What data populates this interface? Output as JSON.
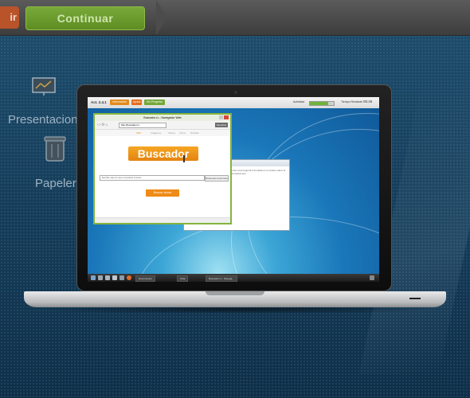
{
  "topbar": {
    "exit_label": "ir",
    "continue_label": "Continuar"
  },
  "background_icons": [
    {
      "name": "presentation-icon",
      "label": "Presentacion"
    },
    {
      "name": "trash-icon",
      "label": "Papelera"
    }
  ],
  "virtual_desktop": {
    "logo": "Act. 2.4.1",
    "tabs": [
      "Información",
      "Ayuda",
      "Ver Progreso"
    ],
    "progress_label": "Actividad",
    "progress": 0.75,
    "timer_label": "Tiempo Restante:",
    "timer_value": "05:45",
    "doc_window_title": "notas",
    "doc_window_text": "ciente a la pregunta formulada en el enlace sobre la alternativa que",
    "browser": {
      "title": "Buscador.cl – Navegador Web",
      "tab": "Chat",
      "url": "http://buscador.cl",
      "go_label": "Favoritos",
      "menu_items": [
        "Web",
        "Imágenes",
        "Videos",
        "Libros",
        "Noticias"
      ],
      "brand": "Buscador",
      "search_placeholder": "Escribe aquí lo que necesitas buscar...",
      "advanced_label": "Búsqueda avanzada",
      "search_button": "Buscar ahora"
    },
    "taskbar": {
      "tasks": [
        "Documentos",
        "Chat",
        "Buscador.cl – Navega..."
      ]
    }
  },
  "colors": {
    "continue_green": "#6e9c2c",
    "exit_orange": "#b8532a",
    "brand_orange": "#ef8b16"
  }
}
